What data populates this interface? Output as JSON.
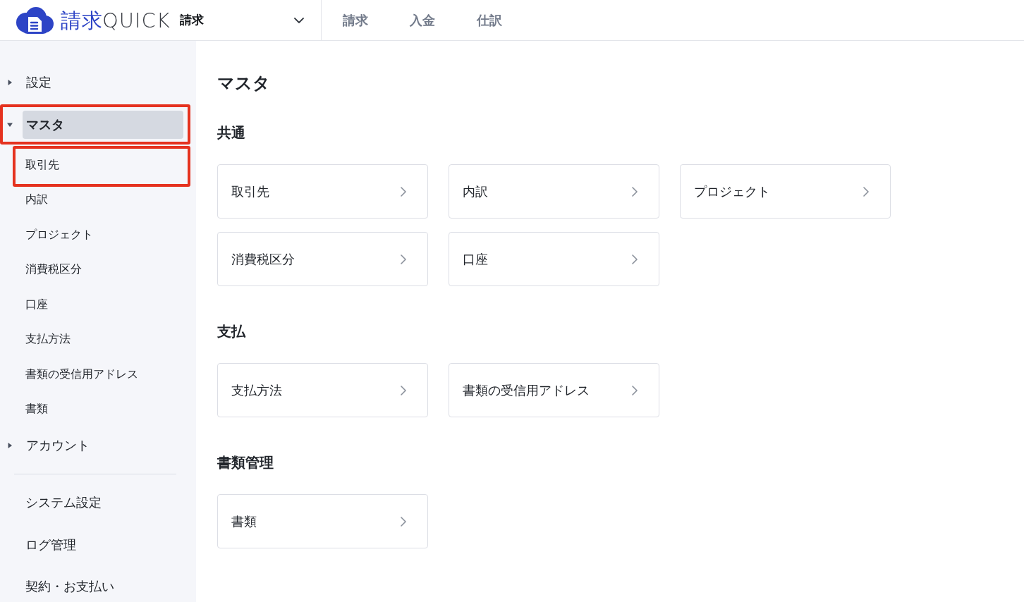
{
  "header": {
    "logo": {
      "kanji": "請求",
      "latin": "QUICK"
    },
    "product_switcher": {
      "label": "請求"
    },
    "nav_tabs": [
      {
        "label": "請求",
        "selected": false
      },
      {
        "label": "入金",
        "selected": false
      },
      {
        "label": "仕訳",
        "selected": false
      }
    ]
  },
  "sidebar": {
    "groups": [
      {
        "label": "設定",
        "expanded": false,
        "selected": false,
        "highlighted": false
      },
      {
        "label": "マスタ",
        "expanded": true,
        "selected": true,
        "highlighted": true,
        "children": [
          {
            "label": "取引先",
            "selected": false,
            "highlighted": true
          },
          {
            "label": "内訳",
            "selected": false,
            "highlighted": false
          },
          {
            "label": "プロジェクト",
            "selected": false,
            "highlighted": false
          },
          {
            "label": "消費税区分",
            "selected": false,
            "highlighted": false
          },
          {
            "label": "口座",
            "selected": false,
            "highlighted": false
          },
          {
            "label": "支払方法",
            "selected": false,
            "highlighted": false
          },
          {
            "label": "書類の受信用アドレス",
            "selected": false,
            "highlighted": false
          },
          {
            "label": "書類",
            "selected": false,
            "highlighted": false
          }
        ]
      },
      {
        "label": "アカウント",
        "expanded": false,
        "selected": false,
        "highlighted": false
      }
    ],
    "links": [
      "システム設定",
      "ログ管理",
      "契約・お支払い"
    ]
  },
  "main": {
    "title": "マスタ",
    "sections": [
      {
        "heading": "共通",
        "cards": [
          "取引先",
          "内訳",
          "プロジェクト",
          "消費税区分",
          "口座"
        ]
      },
      {
        "heading": "支払",
        "cards": [
          "支払方法",
          "書類の受信用アドレス"
        ]
      },
      {
        "heading": "書類管理",
        "cards": [
          "書類"
        ]
      }
    ]
  }
}
